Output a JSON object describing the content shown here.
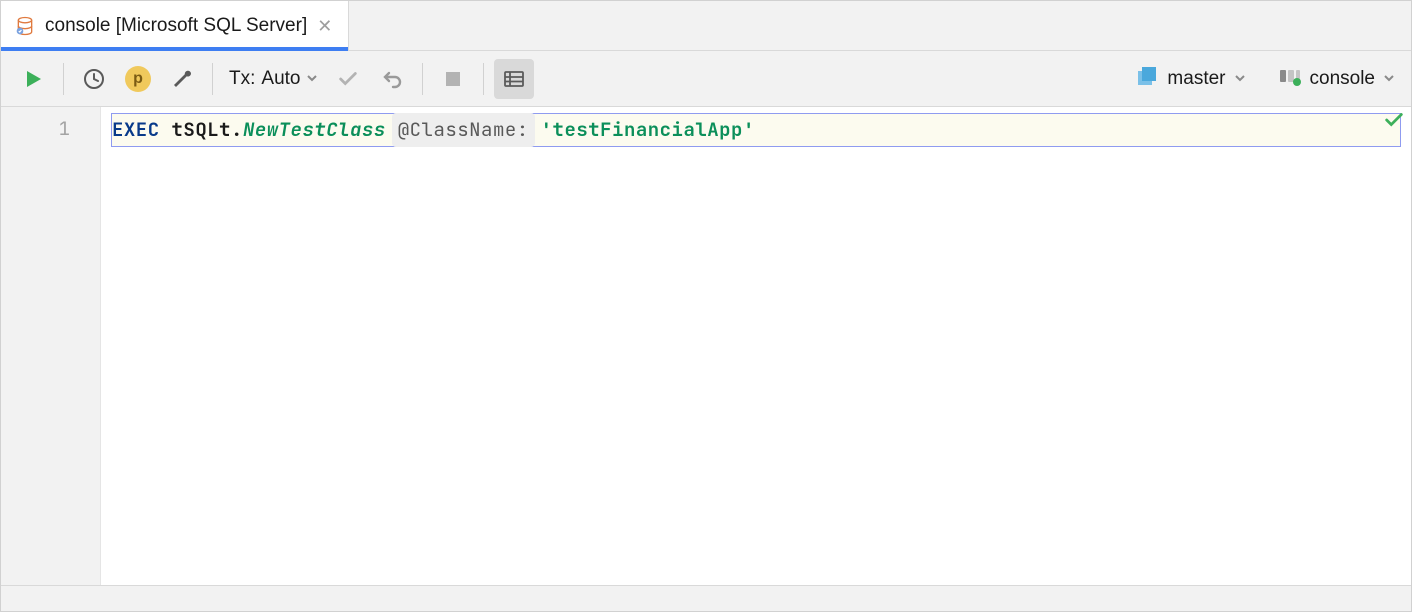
{
  "tab": {
    "title": "console [Microsoft SQL Server]"
  },
  "toolbar": {
    "tx_prefix": "Tx:",
    "tx_mode": "Auto",
    "badge_letter": "p",
    "schema_label": "master",
    "console_label": "console"
  },
  "editor": {
    "line_numbers": [
      "1"
    ],
    "code": {
      "keyword": "EXEC",
      "schema": "tSQLt",
      "dot": ".",
      "function": "NewTestClass",
      "param_hint": "@ClassName:",
      "string_literal": "'testFinancialApp'"
    }
  }
}
